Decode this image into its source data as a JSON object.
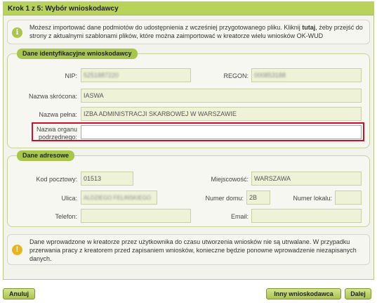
{
  "wizard": {
    "step_title": "Krok 1 z 5: Wybór wnioskodawcy",
    "info": {
      "text_before": "Możesz importować dane podmiotów do udostępnienia z wcześniej przygotowanego pliku. Kliknij ",
      "link": "tutaj",
      "text_after": ", żeby przejść do strony z aktualnymi szablonami plików, które można zaimportować w kreatorze wielu wniosków OK-WUD"
    },
    "identification": {
      "title": "Dane identyfikacyjne wnioskodawcy",
      "nip_label": "NIP:",
      "nip_value": "5251887220",
      "regon_label": "REGON:",
      "regon_value": "000853188",
      "short_name_label": "Nazwa skrócona:",
      "short_name_value": "IASWA",
      "full_name_label": "Nazwa pełna:",
      "full_name_value": "IZBA ADMINISTRACJI SKARBOWEJ W WARSZAWIE",
      "parent_org_label_1": "Nazwa organu",
      "parent_org_label_2": "podrzędnego:",
      "parent_org_value": ""
    },
    "address": {
      "title": "Dane adresowe",
      "postal_code_label": "Kod pocztowy:",
      "postal_code_value": "01513",
      "city_label": "Miejscowość:",
      "city_value": "WARSZAWA",
      "street_label": "Ulica:",
      "street_value": "ALDZIEGO FELIŃSKIEGO",
      "house_no_label": "Numer domu:",
      "house_no_value": "2B",
      "apartment_no_label": "Numer lokalu:",
      "apartment_no_value": "",
      "phone_label": "Telefon:",
      "phone_value": "",
      "email_label": "Email:",
      "email_value": ""
    },
    "warning": "Dane wprowadzone w kreatorze przez użytkownika do czasu utworzenia wniosków nie są utrwalane. W przypadku przerwania pracy z kreatorem przed zapisaniem wniosków, konieczne będzie ponowne wprowadzenie niezapisanych danych."
  },
  "buttons": {
    "cancel": "Anuluj",
    "other_applicant": "Inny wnioskodawca",
    "next": "Dalej"
  },
  "colors": {
    "header_green": "#b9d25a",
    "section_badge_green": "#a8c64b",
    "field_bg": "#eef2d7",
    "highlight_red": "#c8102e",
    "warning_yellow": "#e9b51c"
  }
}
